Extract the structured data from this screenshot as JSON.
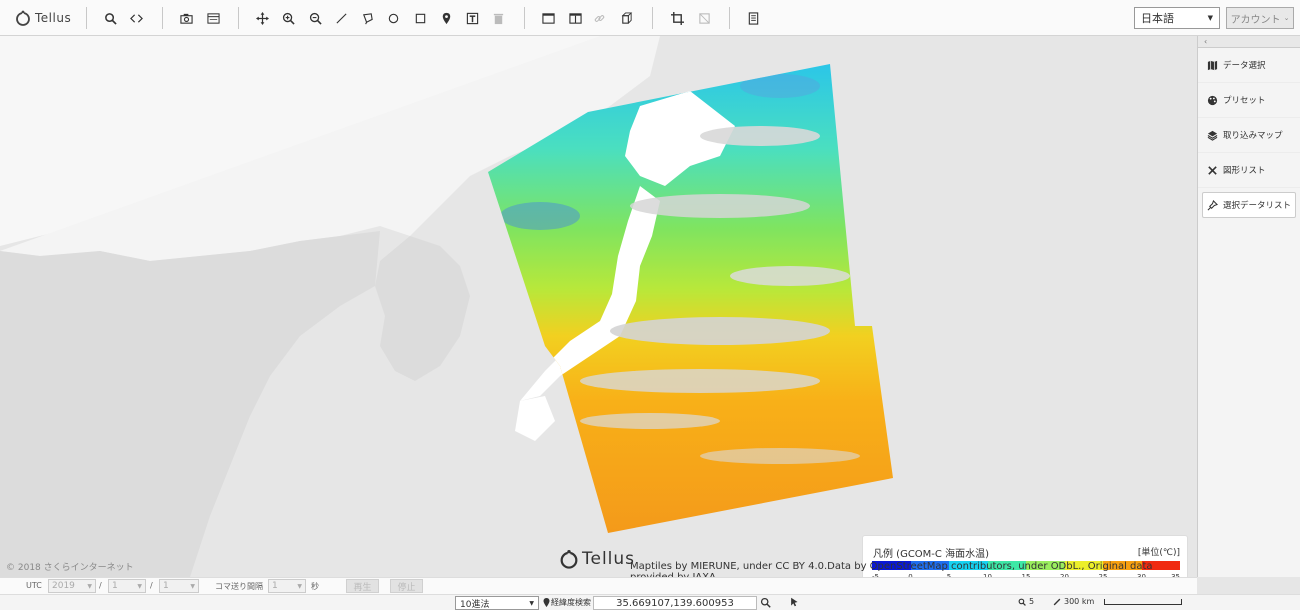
{
  "toolbar": {
    "logo_text": "Tellus",
    "language": "日本語",
    "account": "アカウント"
  },
  "icons": {
    "search": "search-icon",
    "embed": "embed-code-icon",
    "camera": "camera-icon",
    "window": "window-icon",
    "move": "move-icon",
    "zoom_in": "zoom-in-icon",
    "zoom_out": "zoom-out-icon",
    "line": "line-draw-icon",
    "polygon": "polygon-draw-icon",
    "circle": "circle-draw-icon",
    "rectangle": "rectangle-draw-icon",
    "marker": "marker-icon",
    "text": "text-icon",
    "trash": "trash-icon",
    "single_view": "single-view-icon",
    "split_view": "split-view-icon",
    "link": "link-icon",
    "cube": "3d-cube-icon",
    "crop": "crop-icon",
    "crop_off": "crop-off-icon",
    "doc": "document-icon"
  },
  "right_panel": {
    "collapse": "‹",
    "items": [
      {
        "label": "データ選択"
      },
      {
        "label": "プリセット"
      },
      {
        "label": "取り込みマップ"
      },
      {
        "label": "図形リスト"
      },
      {
        "label": "選択データリスト"
      }
    ]
  },
  "legend": {
    "title": "凡例 (GCOM-C 海面水温)",
    "unit": "[単位(℃)]",
    "colors": [
      "#0a18d6",
      "#1e6ef0",
      "#16d2f0",
      "#3ee8a6",
      "#9aee5e",
      "#ecee2a",
      "#f8a010",
      "#f02a10"
    ],
    "ticks": [
      "-5",
      "0",
      "5",
      "10",
      "15",
      "20",
      "25",
      "30",
      "35"
    ]
  },
  "map": {
    "copyright": "© 2018 さくらインターネット",
    "logo_text": "Tellus",
    "attribution": "Maptiles by MIERUNE, under CC BY 4.0.Data by OpenStreetMap contributors, under ODbL., Original data provided by JAXA"
  },
  "timebar": {
    "utc": "UTC",
    "year": "2019",
    "month": "1",
    "day": "1",
    "slash": "/",
    "frame_interval_label": "コマ送り間隔",
    "frame_interval": "1",
    "seconds": "秒",
    "play": "再生",
    "stop": "停止"
  },
  "statusbar": {
    "notation": "10進法",
    "coord_label": "経緯度検索",
    "coordinates": "35.669107,139.600953",
    "zoom": "5",
    "scale": "300 km"
  }
}
